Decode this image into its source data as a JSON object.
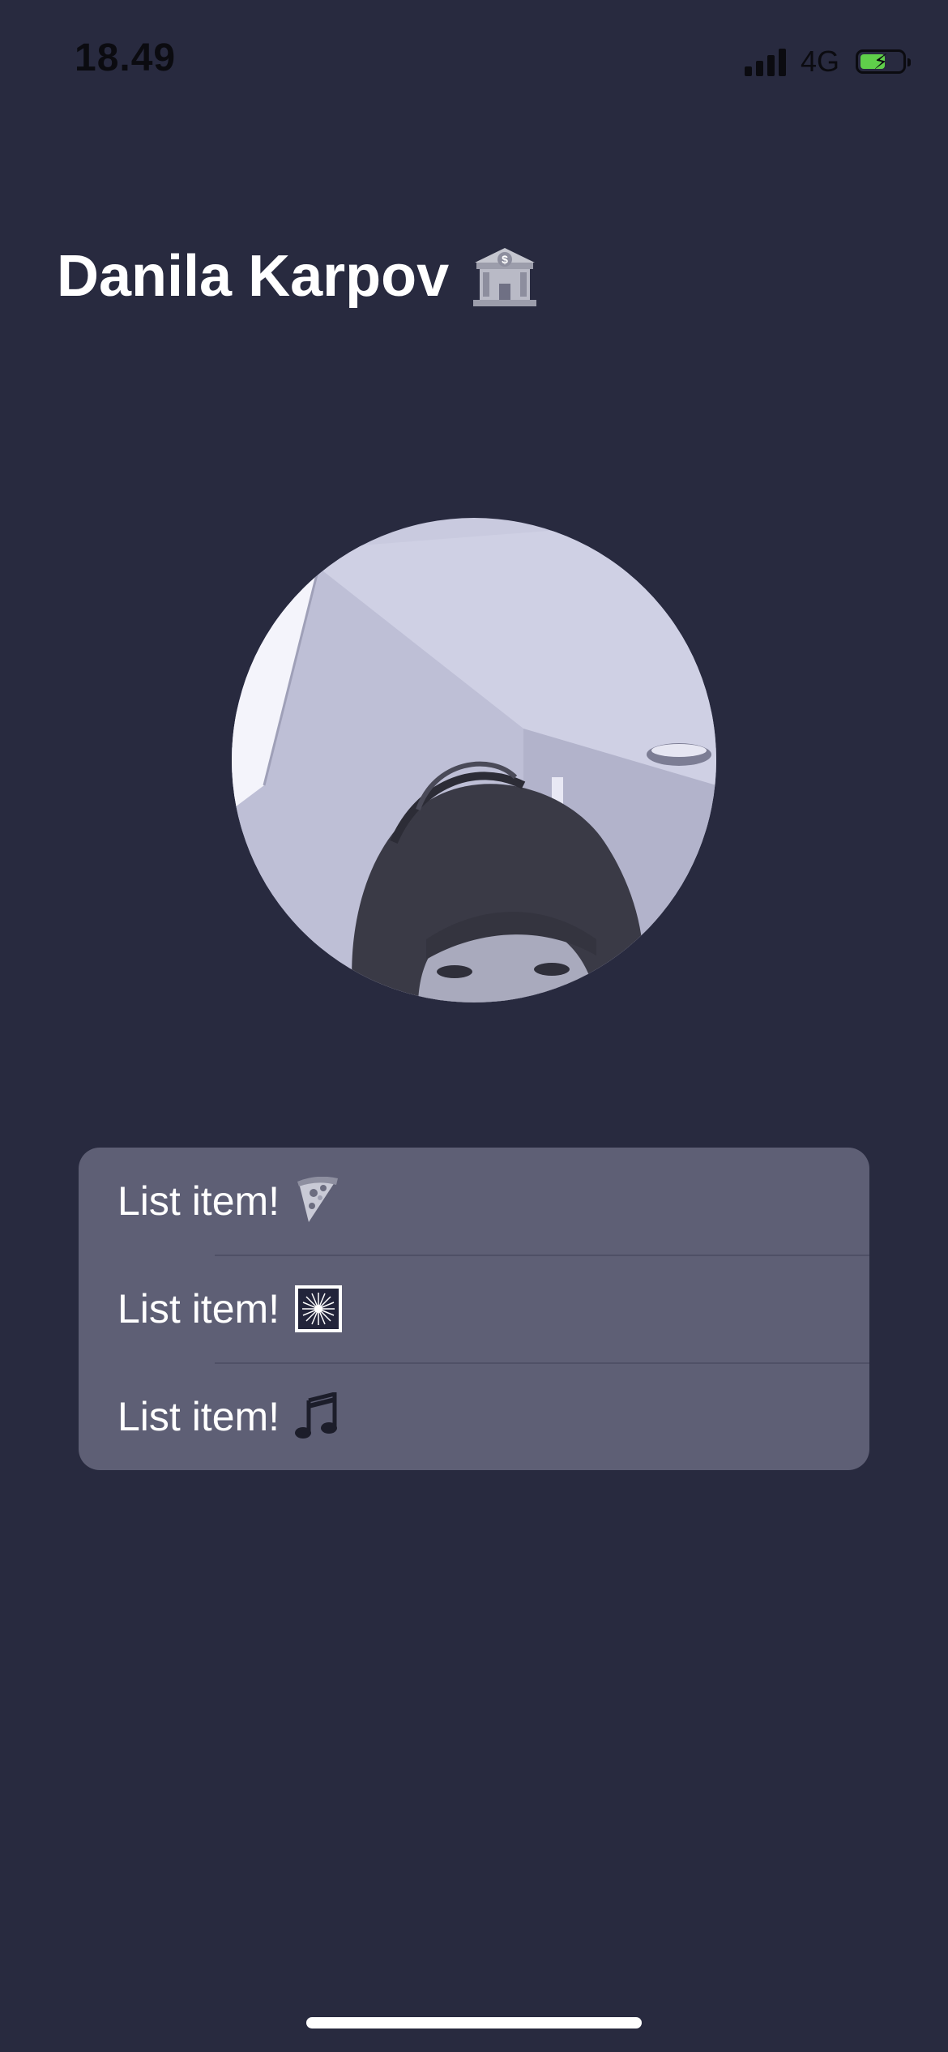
{
  "status_bar": {
    "time": "18.49",
    "network": "4G",
    "battery_charging": true
  },
  "header": {
    "title": "Danila Karpov",
    "title_icon": "bank-icon"
  },
  "avatar": {
    "description": "profile photo"
  },
  "list": {
    "items": [
      {
        "label": "List item!",
        "icon": "pizza-icon"
      },
      {
        "label": "List item!",
        "icon": "fireworks-icon"
      },
      {
        "label": "List item!",
        "icon": "music-note-icon"
      }
    ]
  },
  "colors": {
    "background": "#282a3f",
    "card": "#5e5f75",
    "battery": "#5fcf4a"
  }
}
